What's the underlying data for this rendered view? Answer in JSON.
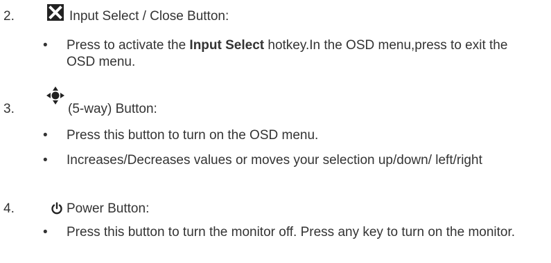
{
  "items": [
    {
      "number": "2.",
      "icon": "close-x-icon",
      "heading": "Input Select / Close Button:",
      "bullets": [
        {
          "pre": "Press to activate the ",
          "bold": "Input Select",
          "post": " hotkey.In the OSD menu,press to exit the OSD menu."
        }
      ]
    },
    {
      "number": "3.",
      "icon": "five-way-joystick-icon",
      "heading": "(5-way) Button:",
      "bullets": [
        {
          "text": "Press this button to turn on the OSD menu."
        },
        {
          "text": "Increases/Decreases values or moves your selection up/down/ left/right"
        }
      ]
    },
    {
      "number": "4.",
      "icon": "power-icon",
      "heading": "Power Button:",
      "bullets": [
        {
          "text": "Press this button to turn the monitor off. Press any key to turn on the monitor."
        }
      ]
    }
  ],
  "bullet_glyph": "•"
}
